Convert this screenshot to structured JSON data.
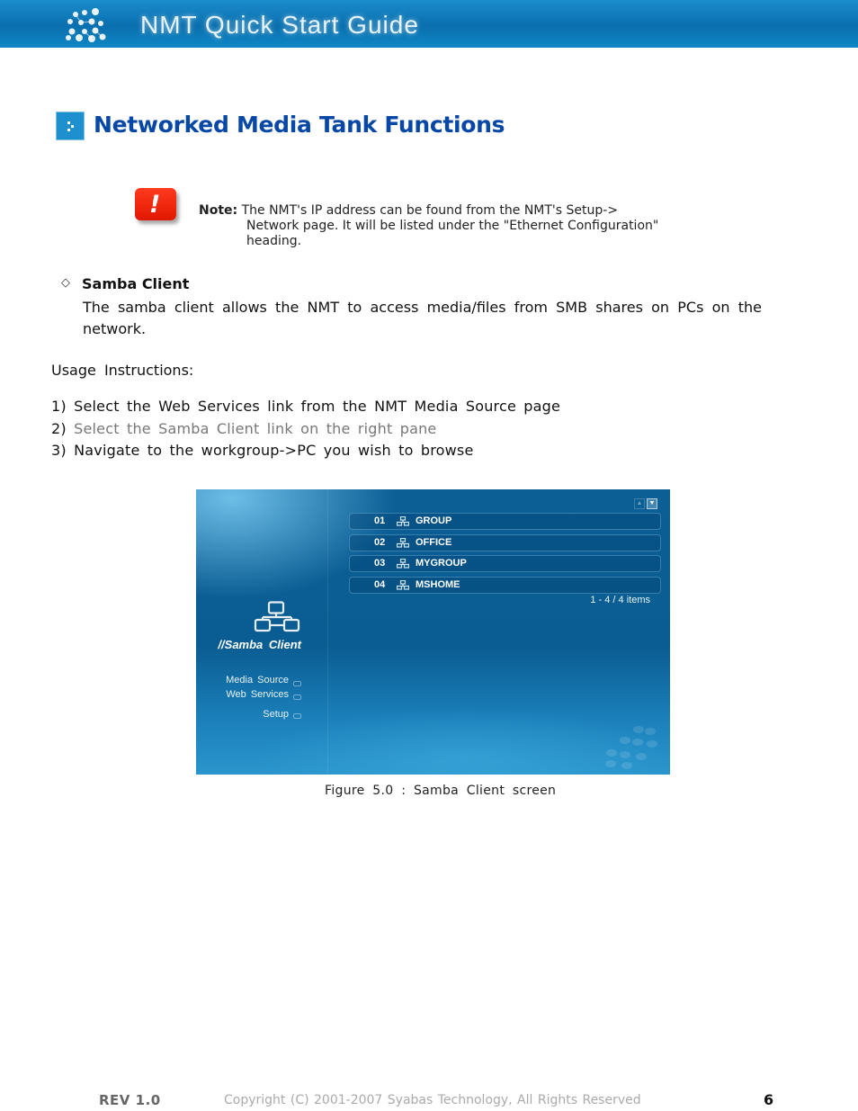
{
  "header": {
    "title": "NMT Quick Start Guide",
    "logo_icon": "dots-network-icon"
  },
  "section": {
    "icon": "section-bullet-icon",
    "title": "Networked Media Tank Functions"
  },
  "note": {
    "icon": "warning-exclamation-icon",
    "icon_glyph": "!",
    "label": "Note:",
    "lines": [
      "The NMT's IP address can be found from the NMT's Setup->",
      "Network page. It will be listed under the \"Ethernet Configuration\"",
      "heading."
    ]
  },
  "samba": {
    "bullet": "◇",
    "heading": "Samba Client",
    "description": "The samba client allows the NMT to access media/files from SMB shares on PCs on the network."
  },
  "usage": {
    "heading": "Usage  Instructions:",
    "steps": [
      {
        "num": "1)",
        "text": "Select the Web Services link from the NMT Media Source page"
      },
      {
        "num": "2)",
        "text": "Select the Samba Client link on the right pane"
      },
      {
        "num": "3)",
        "text": "Navigate to the workgroup->PC you wish to browse"
      }
    ]
  },
  "screenshot": {
    "scroll_up": "▲",
    "scroll_down": "▼",
    "rows": [
      {
        "num": "01",
        "name": "GROUP"
      },
      {
        "num": "02",
        "name": "OFFICE"
      },
      {
        "num": "03",
        "name": "MYGROUP"
      },
      {
        "num": "04",
        "name": "MSHOME"
      }
    ],
    "items_count": "1 - 4 / 4 items",
    "page_label": "//Samba  Client",
    "menu": [
      "Media Source",
      "Web Services",
      "Setup"
    ]
  },
  "caption": "Figure 5.0 : Samba Client screen",
  "footer": {
    "rev": "REV 1.0",
    "copyright": "Copyright (C) 2001-2007 Syabas Technology, All Rights Reserved",
    "page": "6"
  }
}
